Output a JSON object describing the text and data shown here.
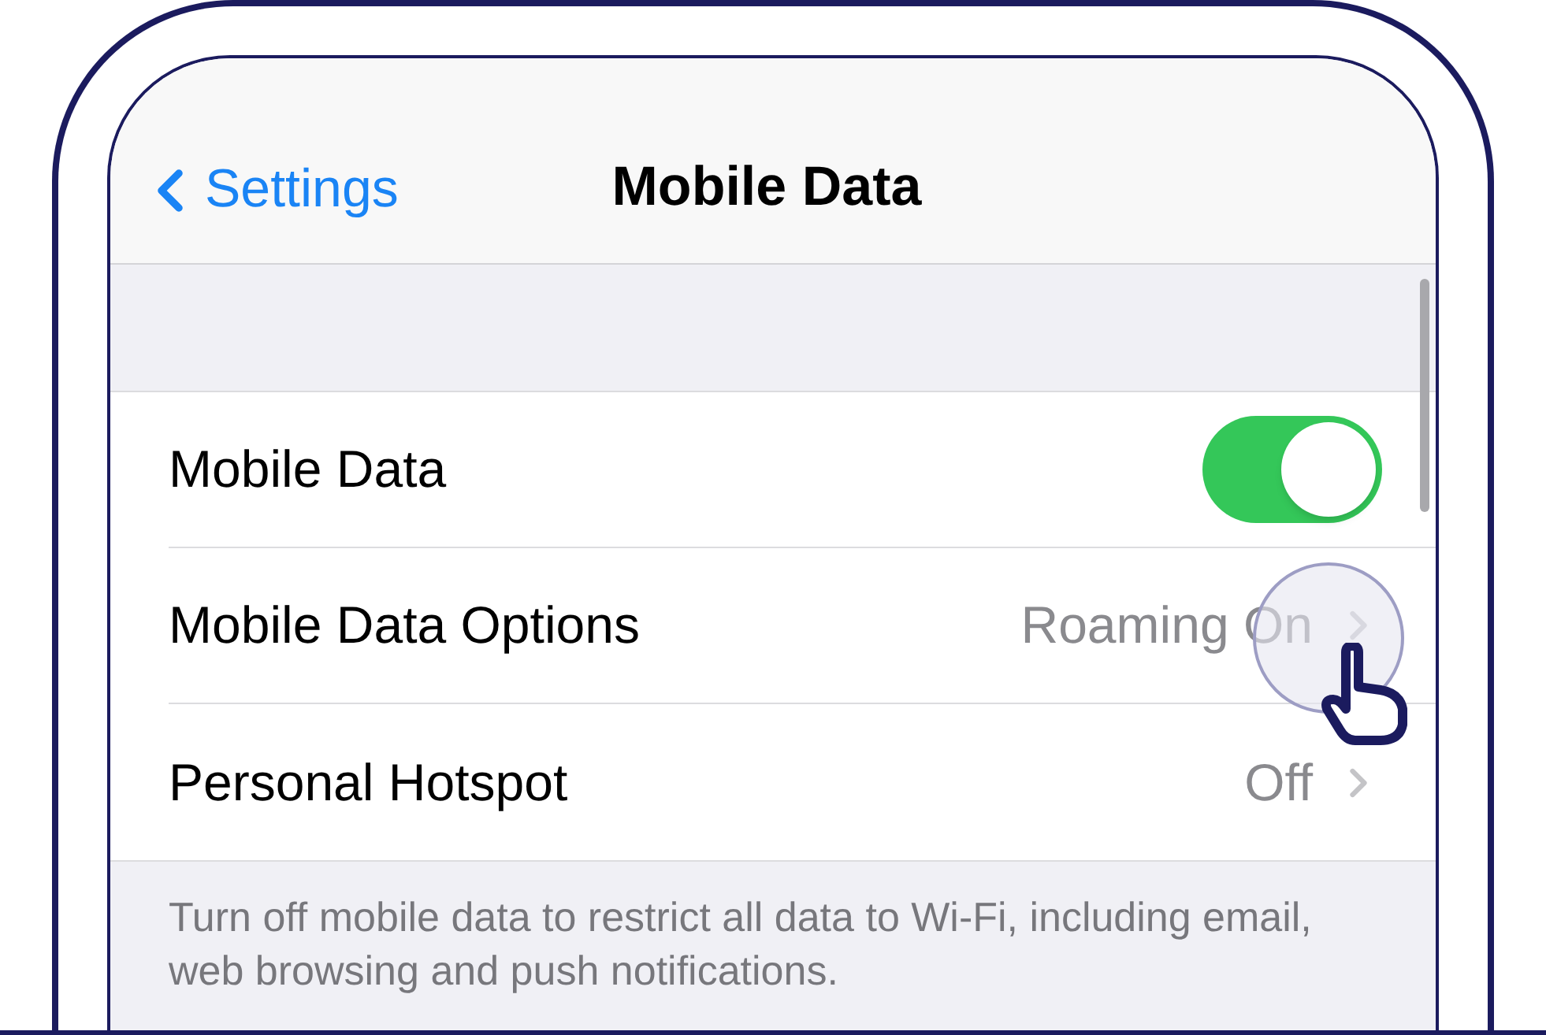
{
  "nav_bar": {
    "back_label": "Settings",
    "title": "Mobile Data"
  },
  "rows": [
    {
      "kind": "toggle",
      "label": "Mobile Data",
      "on": true
    },
    {
      "kind": "link",
      "label": "Mobile Data Options",
      "value": "Roaming On"
    },
    {
      "kind": "link",
      "label": "Personal Hotspot",
      "value": "Off"
    }
  ],
  "footer_note": "Turn off mobile data to restrict all data to Wi-Fi, including email, web browsing and push notifications."
}
